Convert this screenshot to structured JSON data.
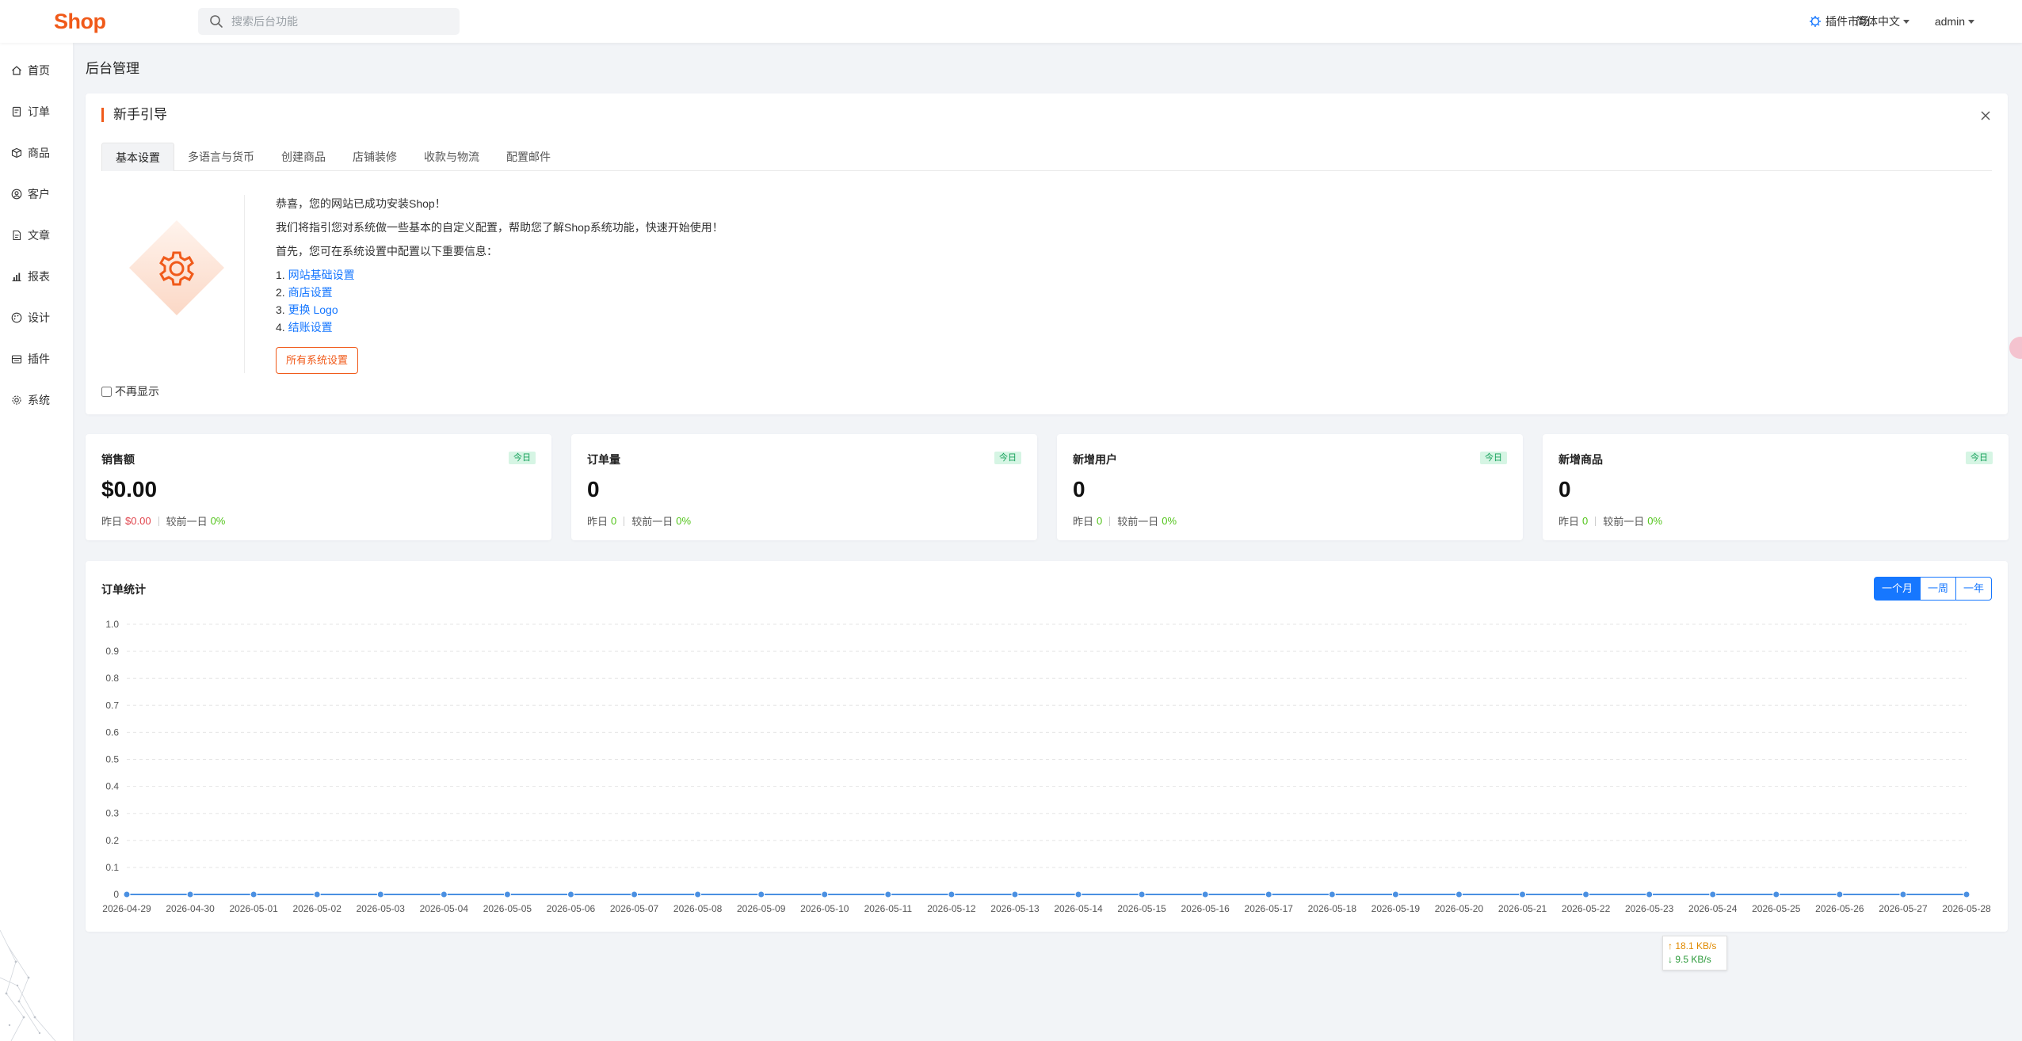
{
  "header": {
    "logo": "Shop",
    "search_placeholder": "搜索后台功能",
    "plugin_market": "插件市场",
    "language": "简体中文",
    "user": "admin"
  },
  "sidebar": {
    "items": [
      {
        "label": "首页",
        "icon": "home-icon"
      },
      {
        "label": "订单",
        "icon": "order-icon"
      },
      {
        "label": "商品",
        "icon": "box-icon"
      },
      {
        "label": "客户",
        "icon": "user-icon"
      },
      {
        "label": "文章",
        "icon": "document-icon"
      },
      {
        "label": "报表",
        "icon": "bar-chart-icon"
      },
      {
        "label": "设计",
        "icon": "palette-icon"
      },
      {
        "label": "插件",
        "icon": "plugin-icon"
      },
      {
        "label": "系统",
        "icon": "gear-icon"
      }
    ]
  },
  "page_title": "后台管理",
  "guide": {
    "title": "新手引导",
    "tabs": [
      "基本设置",
      "多语言与货币",
      "创建商品",
      "店铺装修",
      "收款与物流",
      "配置邮件"
    ],
    "line1": "恭喜，您的网站已成功安装Shop！",
    "line2": "我们将指引您对系统做一些基本的自定义配置，帮助您了解Shop系统功能，快速开始使用！",
    "line3": "首先，您可在系统设置中配置以下重要信息：",
    "links": [
      {
        "num": "1.",
        "label": "网站基础设置"
      },
      {
        "num": "2.",
        "label": "商店设置"
      },
      {
        "num": "3.",
        "label": "更换 Logo"
      },
      {
        "num": "4.",
        "label": "结账设置"
      }
    ],
    "all_settings_button": "所有系统设置",
    "dont_show_again": "不再显示"
  },
  "stats": [
    {
      "title": "销售额",
      "badge": "今日",
      "value": "$0.00",
      "yesterday_label": "昨日",
      "yesterday_value": "$0.00",
      "compare_label": "较前一日",
      "compare_value": "0%"
    },
    {
      "title": "订单量",
      "badge": "今日",
      "value": "0",
      "yesterday_label": "昨日",
      "yesterday_value": "0",
      "compare_label": "较前一日",
      "compare_value": "0%"
    },
    {
      "title": "新增用户",
      "badge": "今日",
      "value": "0",
      "yesterday_label": "昨日",
      "yesterday_value": "0",
      "compare_label": "较前一日",
      "compare_value": "0%"
    },
    {
      "title": "新增商品",
      "badge": "今日",
      "value": "0",
      "yesterday_label": "昨日",
      "yesterday_value": "0",
      "compare_label": "较前一日",
      "compare_value": "0%"
    }
  ],
  "order_chart": {
    "title": "订单统计",
    "ranges": [
      "一个月",
      "一周",
      "一年"
    ],
    "active_range": "一个月"
  },
  "chart_data": {
    "type": "line",
    "title": "",
    "xlabel": "",
    "ylabel": "",
    "ylim": [
      0,
      1
    ],
    "yticks": [
      0,
      0.1,
      0.2,
      0.3,
      0.4,
      0.5,
      0.6,
      0.7,
      0.8,
      0.9,
      1.0
    ],
    "grid": true,
    "x": [
      "2026-04-29",
      "2026-04-30",
      "2026-05-01",
      "2026-05-02",
      "2026-05-03",
      "2026-05-04",
      "2026-05-05",
      "2026-05-06",
      "2026-05-07",
      "2026-05-08",
      "2026-05-09",
      "2026-05-10",
      "2026-05-11",
      "2026-05-12",
      "2026-05-13",
      "2026-05-14",
      "2026-05-15",
      "2026-05-16",
      "2026-05-17",
      "2026-05-18",
      "2026-05-19",
      "2026-05-20",
      "2026-05-21",
      "2026-05-22",
      "2026-05-23",
      "2026-05-24",
      "2026-05-25",
      "2026-05-26",
      "2026-05-27",
      "2026-05-28"
    ],
    "series": [
      {
        "values": [
          0,
          0,
          0,
          0,
          0,
          0,
          0,
          0,
          0,
          0,
          0,
          0,
          0,
          0,
          0,
          0,
          0,
          0,
          0,
          0,
          0,
          0,
          0,
          0,
          0,
          0,
          0,
          0,
          0,
          0
        ]
      }
    ],
    "colors": {
      "line": "#4a90e2",
      "grid": "#e5e5e5"
    }
  },
  "netspeed": {
    "up": "↑ 18.1 KB/s",
    "down": "↓ 9.5 KB/s"
  },
  "colors": {
    "brand": "#f05a1a",
    "link": "#1677ff",
    "success": "#52c41a",
    "danger": "#e0434b"
  }
}
